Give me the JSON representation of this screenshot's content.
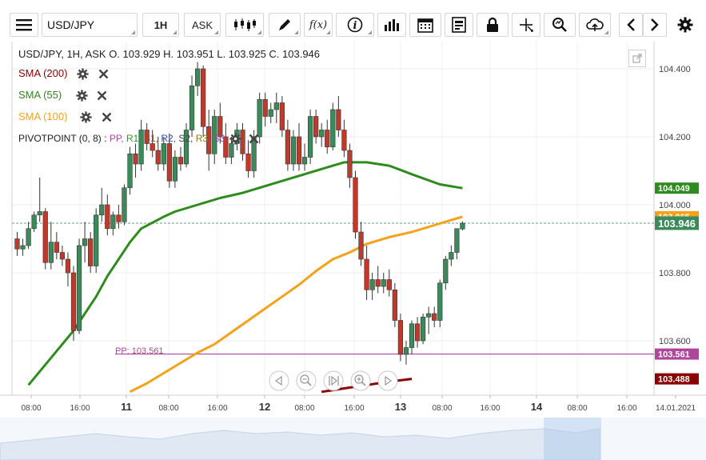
{
  "toolbar": {
    "symbol": "USD/JPY",
    "timeframe": "1H",
    "price_type": "ASK",
    "function_label": "f(x)"
  },
  "legend": {
    "ohlc": "USD/JPY, 1H, ASK   O. 103.929 H. 103.951 L. 103.925 C. 103.946",
    "sma200": "SMA (200)",
    "sma55": "SMA (55)",
    "sma100": "SMA (100)",
    "pivot_prefix": "PIVOTPOINT (0, 8)  :",
    "pivot_items": [
      {
        "label": "PP,",
        "color": "#b0469b"
      },
      {
        "label": "R1,",
        "color": "#2e9b2e"
      },
      {
        "label": "S1,",
        "color": "#b04a1e"
      },
      {
        "label": "R2,",
        "color": "#3252a8"
      },
      {
        "label": "S2,",
        "color": "#444444"
      },
      {
        "label": "R3,",
        "color": "#8a7a1a"
      },
      {
        "label": "S3",
        "color": "#9b46b0"
      }
    ],
    "pp_line_label": "PP: 103.561"
  },
  "colors": {
    "up": "#3a8a5a",
    "down": "#c0392b",
    "sma200": "#8b0000",
    "sma55": "#2e8b1e",
    "sma100": "#f5a21b",
    "pivot": "#b0469b"
  },
  "price_tags": [
    {
      "value": "104.049",
      "color": "#2e8b1e"
    },
    {
      "value": "103.965",
      "color": "#f5a21b"
    },
    {
      "value": "103.946",
      "color": "#3a8a5a"
    },
    {
      "value": "103.561",
      "color": "#b0469b"
    },
    {
      "value": "103.488",
      "color": "#8b0000"
    }
  ],
  "chart_data": {
    "type": "candlestick",
    "symbol": "USD/JPY",
    "interval": "1H",
    "price_type": "ASK",
    "y_ticks": [
      103.6,
      103.8,
      104.0,
      104.2,
      104.4
    ],
    "y_tick_labels": [
      "103.600",
      "103.800",
      "104.000",
      "104.200",
      "104.400"
    ],
    "ylim": [
      103.42,
      104.5
    ],
    "x_tick_labels": [
      "08:00",
      "16:00",
      "11",
      "08:00",
      "16:00",
      "12",
      "08:00",
      "16:00",
      "13",
      "08:00",
      "16:00",
      "14",
      "08:00",
      "16:00",
      "14.01.2021"
    ],
    "x_tick_bold": [
      false,
      false,
      true,
      false,
      false,
      true,
      false,
      false,
      true,
      false,
      false,
      true,
      false,
      false,
      false
    ],
    "last_close": 103.946,
    "ohlc_last": {
      "open": 103.929,
      "high": 103.951,
      "low": 103.925,
      "close": 103.946
    },
    "candles": [
      {
        "o": 103.9,
        "h": 103.92,
        "l": 103.85,
        "c": 103.87
      },
      {
        "o": 103.87,
        "h": 103.9,
        "l": 103.85,
        "c": 103.88
      },
      {
        "o": 103.88,
        "h": 103.95,
        "l": 103.87,
        "c": 103.93
      },
      {
        "o": 103.93,
        "h": 103.98,
        "l": 103.92,
        "c": 103.97
      },
      {
        "o": 103.97,
        "h": 104.08,
        "l": 103.95,
        "c": 103.98
      },
      {
        "o": 103.98,
        "h": 103.99,
        "l": 103.81,
        "c": 103.83
      },
      {
        "o": 103.83,
        "h": 103.95,
        "l": 103.81,
        "c": 103.89
      },
      {
        "o": 103.89,
        "h": 103.92,
        "l": 103.84,
        "c": 103.86
      },
      {
        "o": 103.86,
        "h": 103.88,
        "l": 103.82,
        "c": 103.84
      },
      {
        "o": 103.84,
        "h": 103.86,
        "l": 103.76,
        "c": 103.8
      },
      {
        "o": 103.8,
        "h": 103.82,
        "l": 103.6,
        "c": 103.63
      },
      {
        "o": 103.63,
        "h": 103.9,
        "l": 103.62,
        "c": 103.88
      },
      {
        "o": 103.88,
        "h": 103.95,
        "l": 103.83,
        "c": 103.9
      },
      {
        "o": 103.9,
        "h": 103.92,
        "l": 103.8,
        "c": 103.82
      },
      {
        "o": 103.82,
        "h": 103.99,
        "l": 103.8,
        "c": 103.97
      },
      {
        "o": 103.97,
        "h": 104.05,
        "l": 103.95,
        "c": 104.0
      },
      {
        "o": 104.0,
        "h": 104.03,
        "l": 103.91,
        "c": 103.93
      },
      {
        "o": 103.93,
        "h": 103.98,
        "l": 103.91,
        "c": 103.97
      },
      {
        "o": 103.97,
        "h": 104.0,
        "l": 103.93,
        "c": 103.95
      },
      {
        "o": 103.95,
        "h": 104.06,
        "l": 103.94,
        "c": 104.05
      },
      {
        "o": 104.05,
        "h": 104.17,
        "l": 104.03,
        "c": 104.15
      },
      {
        "o": 104.15,
        "h": 104.18,
        "l": 104.08,
        "c": 104.12
      },
      {
        "o": 104.12,
        "h": 104.25,
        "l": 104.1,
        "c": 104.22
      },
      {
        "o": 104.22,
        "h": 104.24,
        "l": 104.16,
        "c": 104.18
      },
      {
        "o": 104.18,
        "h": 104.22,
        "l": 104.14,
        "c": 104.16
      },
      {
        "o": 104.16,
        "h": 104.2,
        "l": 104.1,
        "c": 104.12
      },
      {
        "o": 104.12,
        "h": 104.2,
        "l": 104.1,
        "c": 104.18
      },
      {
        "o": 104.18,
        "h": 104.21,
        "l": 104.05,
        "c": 104.07
      },
      {
        "o": 104.07,
        "h": 104.16,
        "l": 104.05,
        "c": 104.14
      },
      {
        "o": 104.14,
        "h": 104.17,
        "l": 104.1,
        "c": 104.12
      },
      {
        "o": 104.12,
        "h": 104.24,
        "l": 104.11,
        "c": 104.22
      },
      {
        "o": 104.22,
        "h": 104.38,
        "l": 104.2,
        "c": 104.35
      },
      {
        "o": 104.35,
        "h": 104.42,
        "l": 104.32,
        "c": 104.4
      },
      {
        "o": 104.4,
        "h": 104.41,
        "l": 104.2,
        "c": 104.23
      },
      {
        "o": 104.23,
        "h": 104.28,
        "l": 104.1,
        "c": 104.15
      },
      {
        "o": 104.15,
        "h": 104.28,
        "l": 104.12,
        "c": 104.26
      },
      {
        "o": 104.26,
        "h": 104.3,
        "l": 104.18,
        "c": 104.2
      },
      {
        "o": 104.2,
        "h": 104.24,
        "l": 104.12,
        "c": 104.14
      },
      {
        "o": 104.14,
        "h": 104.2,
        "l": 104.12,
        "c": 104.18
      },
      {
        "o": 104.18,
        "h": 104.24,
        "l": 104.16,
        "c": 104.22
      },
      {
        "o": 104.22,
        "h": 104.24,
        "l": 104.13,
        "c": 104.15
      },
      {
        "o": 104.15,
        "h": 104.19,
        "l": 104.08,
        "c": 104.1
      },
      {
        "o": 104.1,
        "h": 104.22,
        "l": 104.08,
        "c": 104.2
      },
      {
        "o": 104.2,
        "h": 104.33,
        "l": 104.18,
        "c": 104.31
      },
      {
        "o": 104.31,
        "h": 104.33,
        "l": 104.23,
        "c": 104.26
      },
      {
        "o": 104.26,
        "h": 104.3,
        "l": 104.24,
        "c": 104.28
      },
      {
        "o": 104.28,
        "h": 104.33,
        "l": 104.24,
        "c": 104.3
      },
      {
        "o": 104.3,
        "h": 104.32,
        "l": 104.2,
        "c": 104.22
      },
      {
        "o": 104.22,
        "h": 104.25,
        "l": 104.1,
        "c": 104.12
      },
      {
        "o": 104.12,
        "h": 104.22,
        "l": 104.1,
        "c": 104.2
      },
      {
        "o": 104.2,
        "h": 104.24,
        "l": 104.1,
        "c": 104.12
      },
      {
        "o": 104.12,
        "h": 104.18,
        "l": 104.1,
        "c": 104.14
      },
      {
        "o": 104.14,
        "h": 104.28,
        "l": 104.12,
        "c": 104.26
      },
      {
        "o": 104.26,
        "h": 104.28,
        "l": 104.18,
        "c": 104.2
      },
      {
        "o": 104.2,
        "h": 104.24,
        "l": 104.17,
        "c": 104.22
      },
      {
        "o": 104.22,
        "h": 104.25,
        "l": 104.15,
        "c": 104.17
      },
      {
        "o": 104.17,
        "h": 104.3,
        "l": 104.16,
        "c": 104.28
      },
      {
        "o": 104.28,
        "h": 104.32,
        "l": 104.2,
        "c": 104.22
      },
      {
        "o": 104.22,
        "h": 104.25,
        "l": 104.14,
        "c": 104.16
      },
      {
        "o": 104.16,
        "h": 104.18,
        "l": 104.05,
        "c": 104.08
      },
      {
        "o": 104.08,
        "h": 104.1,
        "l": 103.9,
        "c": 103.92
      },
      {
        "o": 103.92,
        "h": 103.95,
        "l": 103.82,
        "c": 103.84
      },
      {
        "o": 103.84,
        "h": 103.88,
        "l": 103.72,
        "c": 103.75
      },
      {
        "o": 103.75,
        "h": 103.8,
        "l": 103.72,
        "c": 103.78
      },
      {
        "o": 103.78,
        "h": 103.82,
        "l": 103.74,
        "c": 103.76
      },
      {
        "o": 103.76,
        "h": 103.8,
        "l": 103.74,
        "c": 103.78
      },
      {
        "o": 103.78,
        "h": 103.81,
        "l": 103.73,
        "c": 103.75
      },
      {
        "o": 103.75,
        "h": 103.77,
        "l": 103.64,
        "c": 103.66
      },
      {
        "o": 103.66,
        "h": 103.68,
        "l": 103.54,
        "c": 103.56
      },
      {
        "o": 103.56,
        "h": 103.6,
        "l": 103.53,
        "c": 103.58
      },
      {
        "o": 103.58,
        "h": 103.66,
        "l": 103.56,
        "c": 103.65
      },
      {
        "o": 103.65,
        "h": 103.67,
        "l": 103.58,
        "c": 103.6
      },
      {
        "o": 103.6,
        "h": 103.68,
        "l": 103.59,
        "c": 103.67
      },
      {
        "o": 103.67,
        "h": 103.7,
        "l": 103.62,
        "c": 103.68
      },
      {
        "o": 103.68,
        "h": 103.7,
        "l": 103.64,
        "c": 103.66
      },
      {
        "o": 103.66,
        "h": 103.78,
        "l": 103.64,
        "c": 103.77
      },
      {
        "o": 103.77,
        "h": 103.85,
        "l": 103.75,
        "c": 103.84
      },
      {
        "o": 103.84,
        "h": 103.88,
        "l": 103.82,
        "c": 103.86
      },
      {
        "o": 103.86,
        "h": 103.93,
        "l": 103.84,
        "c": 103.93
      },
      {
        "o": 103.929,
        "h": 103.951,
        "l": 103.925,
        "c": 103.946
      }
    ],
    "series": [
      {
        "name": "SMA (200)",
        "color": "#8b0000",
        "values": [
          [
            70,
            103.488
          ],
          [
            66,
            103.48
          ],
          [
            62,
            103.47
          ],
          [
            58,
            103.46
          ],
          [
            54,
            103.45
          ]
        ],
        "clip_below": 103.455
      },
      {
        "name": "SMA (55)",
        "color": "#2e8b1e",
        "values": [
          [
            79,
            104.049
          ],
          [
            75,
            104.06
          ],
          [
            70,
            104.09
          ],
          [
            66,
            104.115
          ],
          [
            62,
            104.125
          ],
          [
            58,
            104.125
          ],
          [
            56,
            104.115
          ],
          [
            52,
            104.095
          ],
          [
            48,
            104.075
          ],
          [
            44,
            104.055
          ],
          [
            40,
            104.035
          ],
          [
            36,
            104.02
          ],
          [
            32,
            104.0
          ],
          [
            28,
            103.98
          ],
          [
            26,
            103.965
          ],
          [
            22,
            103.93
          ],
          [
            20,
            103.89
          ],
          [
            18,
            103.84
          ],
          [
            16,
            103.79
          ],
          [
            14,
            103.73
          ],
          [
            12,
            103.68
          ],
          [
            10,
            103.63
          ],
          [
            8,
            103.59
          ],
          [
            6,
            103.55
          ],
          [
            4,
            103.51
          ],
          [
            2,
            103.47
          ]
        ]
      },
      {
        "name": "SMA (100)",
        "color": "#f5a21b",
        "values": [
          [
            79,
            103.965
          ],
          [
            77,
            103.955
          ],
          [
            74,
            103.94
          ],
          [
            70,
            103.92
          ],
          [
            66,
            103.905
          ],
          [
            62,
            103.885
          ],
          [
            59,
            103.86
          ],
          [
            56,
            103.84
          ],
          [
            53,
            103.805
          ],
          [
            50,
            103.765
          ],
          [
            47,
            103.73
          ],
          [
            44,
            103.695
          ],
          [
            41,
            103.66
          ],
          [
            38,
            103.625
          ],
          [
            35,
            103.59
          ],
          [
            32,
            103.565
          ],
          [
            29,
            103.535
          ],
          [
            26,
            103.505
          ],
          [
            23,
            103.475
          ],
          [
            20,
            103.45
          ]
        ]
      }
    ],
    "pivot": {
      "name": "PP",
      "value": 103.561
    },
    "current_price_line": 103.946
  }
}
